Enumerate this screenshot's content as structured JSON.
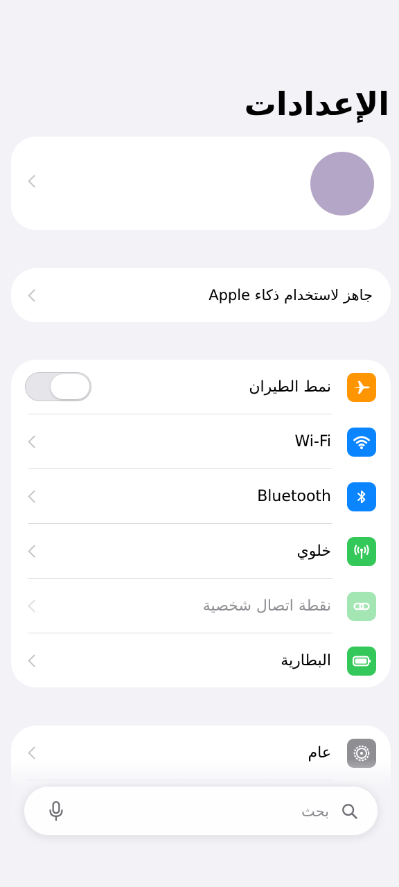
{
  "header": {
    "title": "الإعدادات"
  },
  "profile": {
    "avatar_color": "#b4a6c6"
  },
  "apple_intelligence": {
    "label": "جاهز لاستخدام ذكاء Apple"
  },
  "connectivity": {
    "items": [
      {
        "label": "نمط الطيران",
        "icon": "airplane-icon",
        "color": "#ff9500",
        "control": "toggle",
        "toggle_on": false
      },
      {
        "label": "Wi-Fi",
        "icon": "wifi-icon",
        "color": "#0a84ff",
        "control": "chevron"
      },
      {
        "label": "Bluetooth",
        "icon": "bluetooth-icon",
        "color": "#0a84ff",
        "control": "chevron"
      },
      {
        "label": "خلوي",
        "icon": "cellular-icon",
        "color": "#34c759",
        "control": "chevron"
      },
      {
        "label": "نقطة اتصال شخصية",
        "icon": "hotspot-icon",
        "color": "#34c759",
        "control": "chevron",
        "disabled": true
      },
      {
        "label": "البطارية",
        "icon": "battery-icon",
        "color": "#34c759",
        "control": "chevron"
      }
    ]
  },
  "general": {
    "items": [
      {
        "label": "عام",
        "icon": "gear-icon",
        "color": "#8e8e93"
      }
    ]
  },
  "search": {
    "placeholder": "بحث",
    "search_icon": "magnifier-icon",
    "mic_icon": "microphone-icon"
  }
}
